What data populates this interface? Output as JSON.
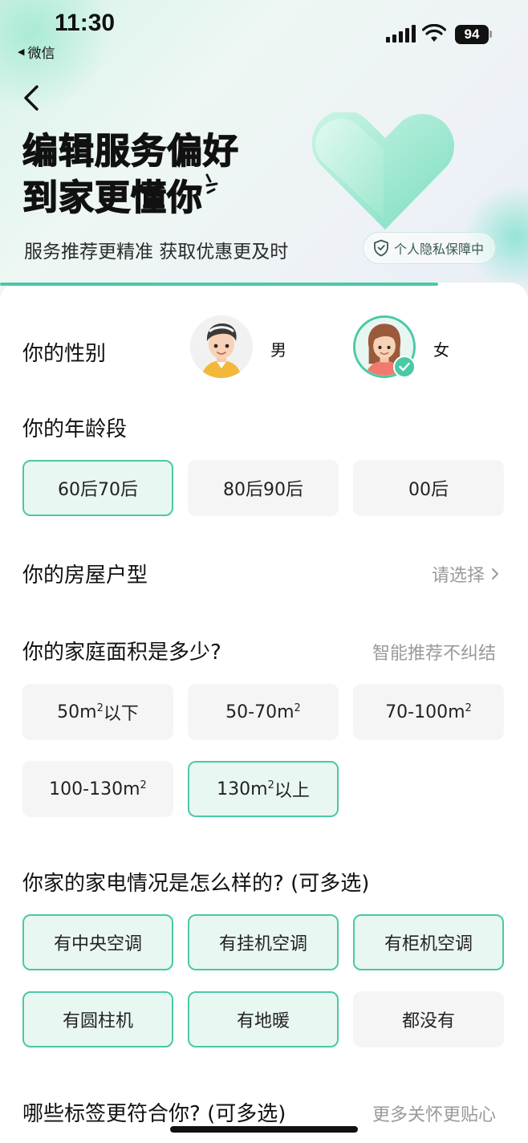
{
  "status": {
    "time": "11:30",
    "back_app": "微信",
    "battery": "94"
  },
  "hero": {
    "title_line1": "编辑服务偏好",
    "title_line2": "到家更懂你",
    "subtitle": "服务推荐更精准 获取优惠更及时",
    "privacy": "个人隐私保障中"
  },
  "progress_fraction": 0.83,
  "gender": {
    "label": "你的性别",
    "male": "男",
    "female": "女",
    "selected": "女"
  },
  "age": {
    "label": "你的年龄段",
    "options": [
      "60后70后",
      "80后90后",
      "00后"
    ],
    "selected": "60后70后"
  },
  "house": {
    "label": "你的房屋户型",
    "placeholder": "请选择"
  },
  "area": {
    "label": "你的家庭面积是多少?",
    "hint": "智能推荐不纠结",
    "options": [
      {
        "text": "50m",
        "sup": "2",
        "tail": "以下"
      },
      {
        "text": "50-70m",
        "sup": "2",
        "tail": ""
      },
      {
        "text": "70-100m",
        "sup": "2",
        "tail": ""
      },
      {
        "text": "100-130m",
        "sup": "2",
        "tail": ""
      },
      {
        "text": "130m",
        "sup": "2",
        "tail": "以上"
      }
    ],
    "selected": "130m²以上"
  },
  "appliances": {
    "label": "你家的家电情况是怎么样的? (可多选)",
    "options": [
      "有中央空调",
      "有挂机空调",
      "有柜机空调",
      "有圆柱机",
      "有地暖",
      "都没有"
    ],
    "selected": [
      "有中央空调",
      "有挂机空调",
      "有柜机空调",
      "有圆柱机",
      "有地暖"
    ]
  },
  "tags": {
    "label": "哪些标签更符合你? (可多选)",
    "hint": "更多关怀更贴心"
  },
  "colors": {
    "accent": "#49c9a6",
    "selected_bg": "#e9f7f3",
    "chip_bg": "#f5f5f5"
  }
}
